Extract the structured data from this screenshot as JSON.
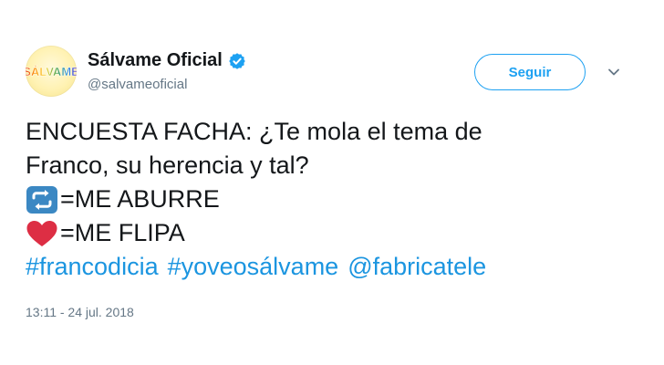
{
  "account": {
    "display_name": "Sálvame Oficial",
    "screen_name": "@salvameoficial",
    "avatar_logo_text": "SÁLVAME",
    "verified_icon": "verified-badge-icon"
  },
  "actions": {
    "follow_label": "Seguir",
    "more_icon": "chevron-down-icon"
  },
  "tweet": {
    "line1": "ENCUESTA FACHA: ¿Te mola el tema de",
    "line2": "Franco, su herencia y tal?",
    "retweet_option": "=ME ABURRE",
    "like_option": "=ME FLIPA",
    "retweet_emoji": "repeat-emoji-icon",
    "like_emoji": "red-heart-emoji-icon",
    "hashtags": [
      "#francodicia",
      "#yoveosálvame",
      "@fabricatele"
    ]
  },
  "timestamp": "13:11 - 24 jul. 2018",
  "colors": {
    "link": "#1b95e0",
    "follow": "#1da1f2",
    "muted": "#657786",
    "text": "#14171a"
  }
}
